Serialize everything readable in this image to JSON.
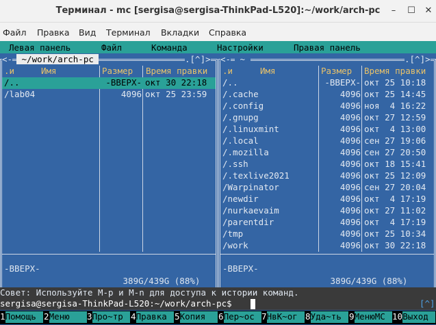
{
  "window": {
    "title": "Терминал - mc [sergisa@sergisa-ThinkPad-L520]:~/work/arch-pc",
    "icons": [
      "minimize-icon",
      "maximize-icon",
      "close-icon"
    ]
  },
  "menubar": [
    "Файл",
    "Правка",
    "Вид",
    "Терминал",
    "Вкладки",
    "Справка"
  ],
  "mc_menu": [
    "Левая панель",
    "Файл",
    "Команда",
    "Настройки",
    "Правая панель"
  ],
  "left_panel": {
    "path": " ~/work/arch-pc ",
    "corner": ".[^]>",
    "corner_left": "<-",
    "headers": {
      "n": ".и",
      "name": "Имя",
      "size": "Размер",
      "time": "Время правки"
    },
    "rows": [
      {
        "name": "/..",
        "size": "-ВВЕРХ-",
        "time": "окт 30 22:18",
        "selected": true
      },
      {
        "name": "/lab04",
        "size": "4096",
        "time": "окт 25 23:59",
        "selected": false
      }
    ],
    "status": "-ВВЕРХ-",
    "disk": " 389G/439G (88%) "
  },
  "right_panel": {
    "path": " ~ ",
    "corner": ".[^]>",
    "corner_left": "<-",
    "headers": {
      "n": ".и",
      "name": "Имя",
      "size": "Размер",
      "time": "Время правки"
    },
    "rows": [
      {
        "name": "/..",
        "size": "-ВВЕРХ-",
        "time": "окт 25 10:18"
      },
      {
        "name": "/.cache",
        "size": "4096",
        "time": "окт 25 14:45"
      },
      {
        "name": "/.config",
        "size": "4096",
        "time": "ноя  4 16:22"
      },
      {
        "name": "/.gnupg",
        "size": "4096",
        "time": "окт 27 12:59"
      },
      {
        "name": "/.linuxmint",
        "size": "4096",
        "time": "окт  4 13:00"
      },
      {
        "name": "/.local",
        "size": "4096",
        "time": "сен 27 19:06"
      },
      {
        "name": "/.mozilla",
        "size": "4096",
        "time": "сен 27 20:50"
      },
      {
        "name": "/.ssh",
        "size": "4096",
        "time": "окт 18 15:41"
      },
      {
        "name": "/.texlive2021",
        "size": "4096",
        "time": "окт 25 12:09"
      },
      {
        "name": "/Warpinator",
        "size": "4096",
        "time": "сен 27 20:04"
      },
      {
        "name": "/newdir",
        "size": "4096",
        "time": "окт  4 17:19"
      },
      {
        "name": "/nurkaevaim",
        "size": "4096",
        "time": "окт 27 11:02"
      },
      {
        "name": "/parentdir",
        "size": "4096",
        "time": "окт  4 17:19"
      },
      {
        "name": "/tmp",
        "size": "4096",
        "time": "окт 25 10:34"
      },
      {
        "name": "/work",
        "size": "4096",
        "time": "окт 30 22:18"
      }
    ],
    "status": "-ВВЕРХ-",
    "disk": " 389G/439G (88%) "
  },
  "hint": "Совет: Используйте M-p и M-n для доступа к истории команд.",
  "prompt": "sergisa@sergisa-ThinkPad-L520:~/work/arch-pc$",
  "prompt_corner": "[^]",
  "fkeys": [
    {
      "num": "1",
      "label": "Помощь"
    },
    {
      "num": "2",
      "label": "Меню"
    },
    {
      "num": "3",
      "label": "Про~тр"
    },
    {
      "num": "4",
      "label": "Правка"
    },
    {
      "num": "5",
      "label": "Копия"
    },
    {
      "num": "6",
      "label": "Пер~ос"
    },
    {
      "num": "7",
      "label": "НвК~ог"
    },
    {
      "num": "8",
      "label": "Уда~ть"
    },
    {
      "num": "9",
      "label": "МенюМС"
    },
    {
      "num": "10",
      "label": "Выход"
    }
  ]
}
